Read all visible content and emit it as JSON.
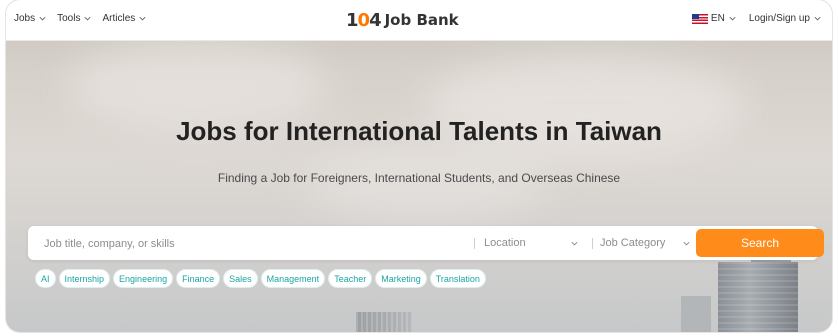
{
  "header": {
    "nav_left": [
      {
        "label": "Jobs",
        "icon": "chevron-down-icon"
      },
      {
        "label": "Tools",
        "icon": "chevron-down-icon"
      },
      {
        "label": "Articles",
        "icon": "chevron-down-icon"
      }
    ],
    "logo": {
      "mark_1": "1",
      "mark_2": "0",
      "mark_3": "4",
      "text": "Job Bank"
    },
    "language": {
      "label": "EN",
      "flag_icon": "us-flag-icon"
    },
    "login_label": "Login/Sign up"
  },
  "hero": {
    "title": "Jobs for International Talents in Taiwan",
    "subtitle": "Finding a Job for Foreigners, International Students, and Overseas Chinese"
  },
  "search": {
    "placeholder": "Job title, company, or skills",
    "location_label": "Location",
    "category_label": "Job Category",
    "button_label": "Search"
  },
  "tags": [
    "AI",
    "Internship",
    "Engineering",
    "Finance",
    "Sales",
    "Management",
    "Teacher",
    "Marketing",
    "Translation"
  ],
  "colors": {
    "accent": "#ff8c1a",
    "tag_text": "#1aa6a6",
    "logo_accent": "#ff7800"
  }
}
